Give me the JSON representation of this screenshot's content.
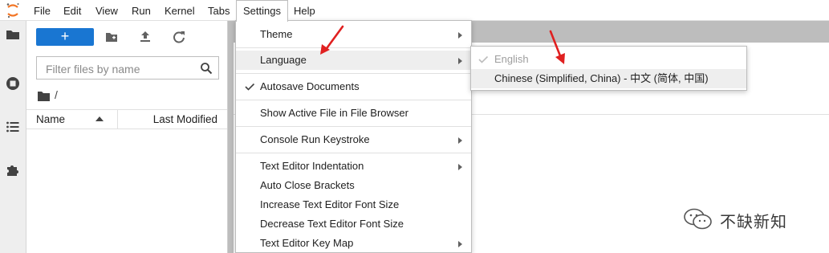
{
  "menubar": {
    "items": [
      "File",
      "Edit",
      "View",
      "Run",
      "Kernel",
      "Tabs",
      "Settings",
      "Help"
    ]
  },
  "sidebar": {
    "icons": [
      "folder-icon",
      "running-icon",
      "toc-icon",
      "extension-icon"
    ]
  },
  "file_browser": {
    "new_label": "+",
    "filter_placeholder": "Filter files by name",
    "breadcrumb": "/",
    "columns": {
      "name": "Name",
      "modified": "Last Modified"
    }
  },
  "settings_menu": {
    "items": [
      {
        "label": "Theme"
      },
      {
        "label": "Language"
      },
      {
        "label": "Autosave Documents"
      },
      {
        "label": "Show Active File in File Browser"
      },
      {
        "label": "Console Run Keystroke"
      },
      {
        "label": "Text Editor Indentation"
      },
      {
        "label": "Auto Close Brackets"
      },
      {
        "label": "Increase Text Editor Font Size"
      },
      {
        "label": "Decrease Text Editor Font Size"
      },
      {
        "label": "Text Editor Key Map"
      }
    ]
  },
  "language_menu": {
    "items": [
      {
        "label": "English"
      },
      {
        "label": "Chinese (Simplified, China) - 中文 (简体, 中国)"
      }
    ]
  },
  "watermark": {
    "text": "不缺新知"
  },
  "colors": {
    "accent": "#1976d2",
    "arrow": "#e02020",
    "logo": "#f37626"
  }
}
